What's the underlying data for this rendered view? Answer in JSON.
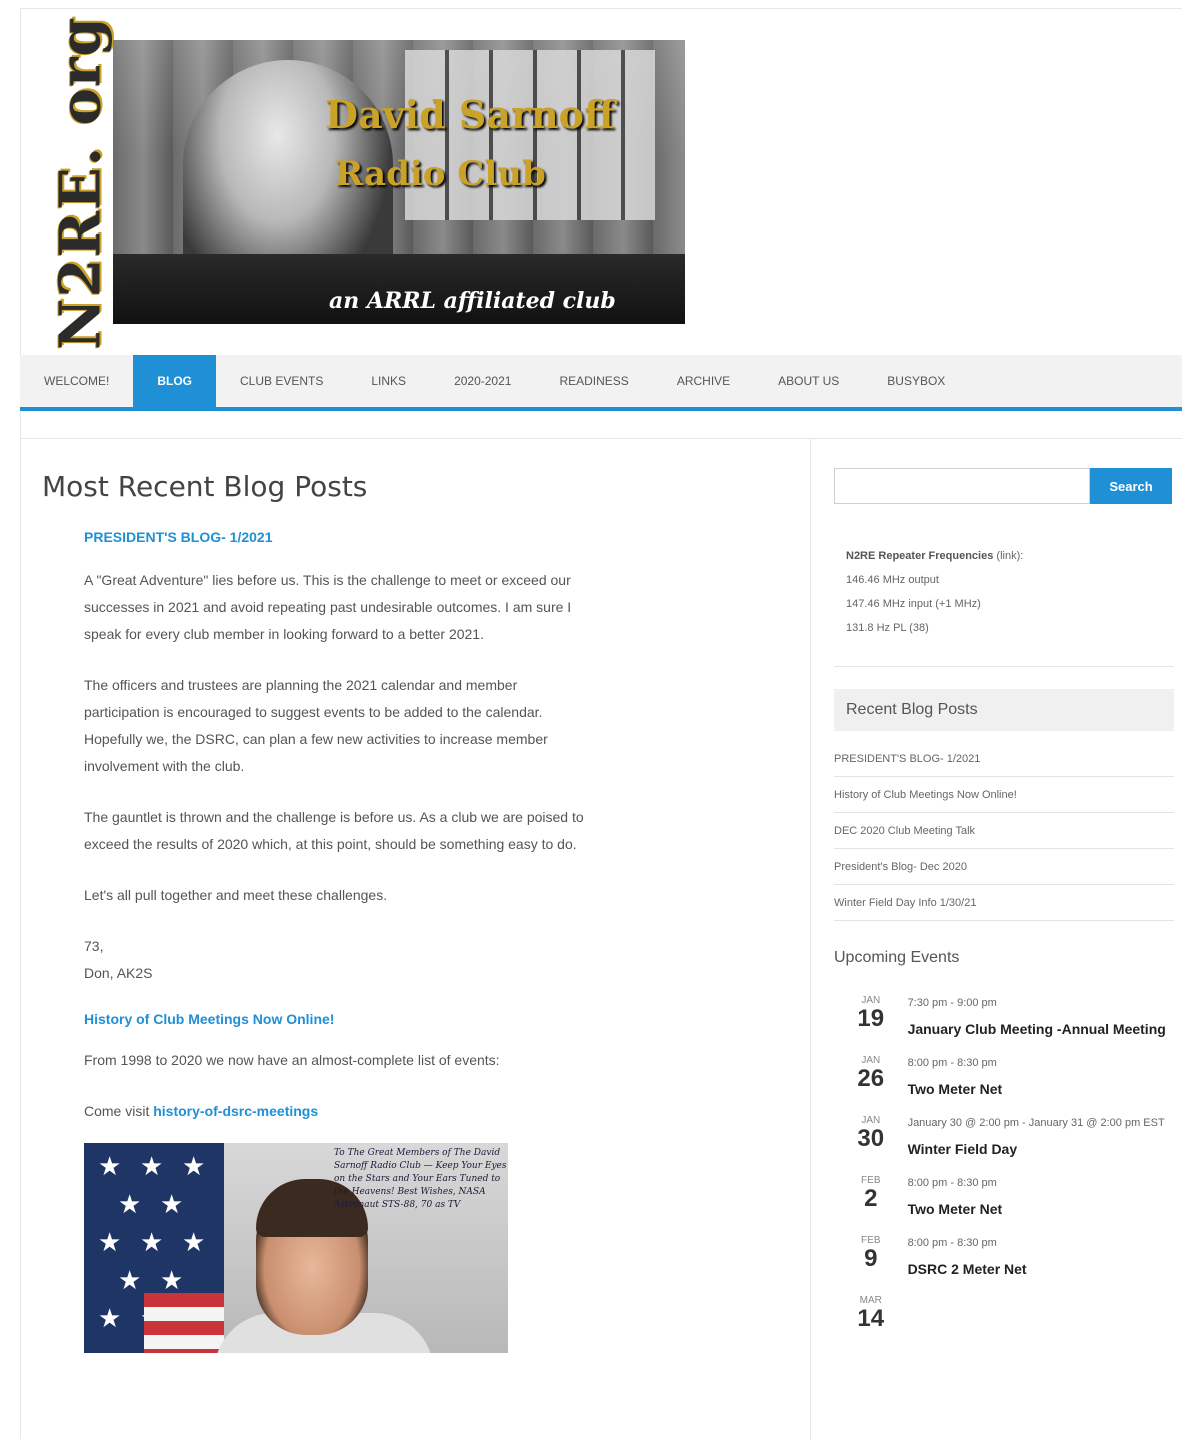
{
  "site": {
    "side_logo": "N2RE. org",
    "banner_title_line1": "David Sarnoff",
    "banner_title_line2": "Radio Club",
    "banner_subtitle": "an ARRL affiliated club"
  },
  "nav": {
    "items": [
      "WELCOME!",
      "BLOG",
      "CLUB EVENTS",
      "LINKS",
      "2020-2021",
      "READINESS",
      "ARCHIVE",
      "ABOUT US",
      "BUSYBOX"
    ],
    "active": "BLOG"
  },
  "main": {
    "page_title": "Most Recent Blog Posts",
    "post1": {
      "title": "PRESIDENT'S BLOG- 1/2021",
      "paragraphs": [
        "A \"Great Adventure\" lies before us. This is the challenge to meet or exceed our successes in 2021 and avoid repeating past undesirable outcomes. I am sure I speak for every club member in looking forward to a better 2021.",
        "The officers and trustees are planning the 2021 calendar and member participation is encouraged to suggest events to be added to the calendar. Hopefully we, the DSRC, can plan a few new activities to increase member involvement with the club.",
        "The gauntlet is thrown and the challenge is before us. As a club we are poised to exceed the results of 2020 which, at this point, should be something easy to do.",
        "Let's all pull together and meet these challenges."
      ],
      "signoff_line1": "73,",
      "signoff_line2": "Don, AK2S"
    },
    "post2": {
      "title": "History of Club Meetings Now Online!",
      "paragraph1": "From 1998 to 2020 we now have an almost-complete list of events:",
      "visit_prefix": "Come visit ",
      "visit_link": "history-of-dsrc-meetings",
      "image_handwriting": "To The Great Members of The David Sarnoff Radio Club — Keep Your Eyes on the Stars and Your Ears Tuned to the Heavens! Best Wishes, NASA Astronaut STS-88, 70 as TV"
    }
  },
  "sidebar": {
    "search_button": "Search",
    "search_placeholder": "",
    "repeater_heading": "N2RE Repeater Frequencies",
    "repeater_link": " (link):",
    "repeater_lines": [
      "146.46 MHz output",
      "147.46 MHz input (+1 MHz)",
      "131.8 Hz PL (38)"
    ],
    "recent_title": "Recent Blog Posts",
    "recent_posts": [
      "PRESIDENT'S BLOG- 1/2021",
      "History of Club Meetings Now Online!",
      "DEC 2020 Club Meeting Talk",
      "President's Blog- Dec 2020",
      "Winter Field Day Info 1/30/21"
    ],
    "events_title": "Upcoming Events",
    "events": [
      {
        "month": "JAN",
        "day": "19",
        "time": "7:30 pm - 9:00 pm",
        "name": "January Club Meeting -Annual Meeting"
      },
      {
        "month": "JAN",
        "day": "26",
        "time": "8:00 pm - 8:30 pm",
        "name": "Two Meter Net"
      },
      {
        "month": "JAN",
        "day": "30",
        "time": "January 30 @ 2:00 pm - January 31 @ 2:00 pm EST",
        "name": "Winter Field Day"
      },
      {
        "month": "FEB",
        "day": "2",
        "time": "8:00 pm - 8:30 pm",
        "name": "Two Meter Net"
      },
      {
        "month": "FEB",
        "day": "9",
        "time": "8:00 pm - 8:30 pm",
        "name": "DSRC 2 Meter Net"
      },
      {
        "month": "MAR",
        "day": "14",
        "time": "",
        "name": ""
      }
    ]
  },
  "colors": {
    "accent": "#1f8fd6",
    "gold": "#c9a227"
  }
}
